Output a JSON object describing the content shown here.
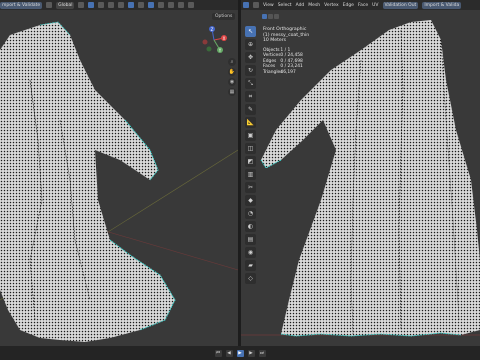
{
  "left_header": {
    "import_validate": "mport & Validate",
    "transform_orientation": "Global"
  },
  "left_viewport": {
    "options_label": "Options",
    "gizmo": {
      "x": "X",
      "y": "Y",
      "z": "Z"
    }
  },
  "right_header": {
    "menu": [
      "View",
      "Select",
      "Add",
      "Mesh",
      "Vertex",
      "Edge",
      "Face",
      "UV"
    ],
    "validation_out": "Validation Out",
    "import_validate": "Import & Valida"
  },
  "right_viewport": {
    "view_name": "Front Orthographic",
    "object_name": "(1) messy_coat_thin",
    "scale": "10 Meters",
    "stats": [
      {
        "label": "Objects",
        "value": "1 / 1"
      },
      {
        "label": "Vertices",
        "value": "0 / 24,458"
      },
      {
        "label": "Edges",
        "value": "0 / 47,698"
      },
      {
        "label": "Faces",
        "value": "0 / 23,241"
      },
      {
        "label": "Triangles",
        "value": "46,197"
      }
    ]
  },
  "tools": [
    {
      "name": "select-box-tool",
      "glyph": "↖",
      "active": true
    },
    {
      "name": "cursor-tool",
      "glyph": "⊕",
      "active": false
    },
    {
      "name": "move-tool",
      "glyph": "✥",
      "active": false
    },
    {
      "name": "rotate-tool",
      "glyph": "↻",
      "active": false
    },
    {
      "name": "scale-tool",
      "glyph": "⤡",
      "active": false
    },
    {
      "name": "transform-tool",
      "glyph": "⌗",
      "active": false
    },
    {
      "name": "annotate-tool",
      "glyph": "✎",
      "active": false
    },
    {
      "name": "measure-tool",
      "glyph": "📐",
      "active": false
    },
    {
      "name": "extrude-tool",
      "glyph": "▣",
      "active": false
    },
    {
      "name": "inset-tool",
      "glyph": "◫",
      "active": false
    },
    {
      "name": "bevel-tool",
      "glyph": "◩",
      "active": false
    },
    {
      "name": "loop-cut-tool",
      "glyph": "▥",
      "active": false
    },
    {
      "name": "knife-tool",
      "glyph": "✂",
      "active": false
    },
    {
      "name": "poly-build-tool",
      "glyph": "◆",
      "active": false
    },
    {
      "name": "spin-tool",
      "glyph": "◔",
      "active": false
    },
    {
      "name": "smooth-tool",
      "glyph": "◐",
      "active": false
    },
    {
      "name": "edge-slide-tool",
      "glyph": "▤",
      "active": false
    },
    {
      "name": "shrink-fatten-tool",
      "glyph": "◉",
      "active": false
    },
    {
      "name": "shear-tool",
      "glyph": "▰",
      "active": false
    },
    {
      "name": "rip-region-tool",
      "glyph": "◇",
      "active": false
    }
  ],
  "colors": {
    "viewport_bg": "#393939",
    "header_bg": "#2b2b2b",
    "accent": "#4772b3",
    "mesh_fill": "#d9d9d9",
    "mesh_dots": "#1a1a1a",
    "boundary_edge": "#3ad7d0"
  }
}
